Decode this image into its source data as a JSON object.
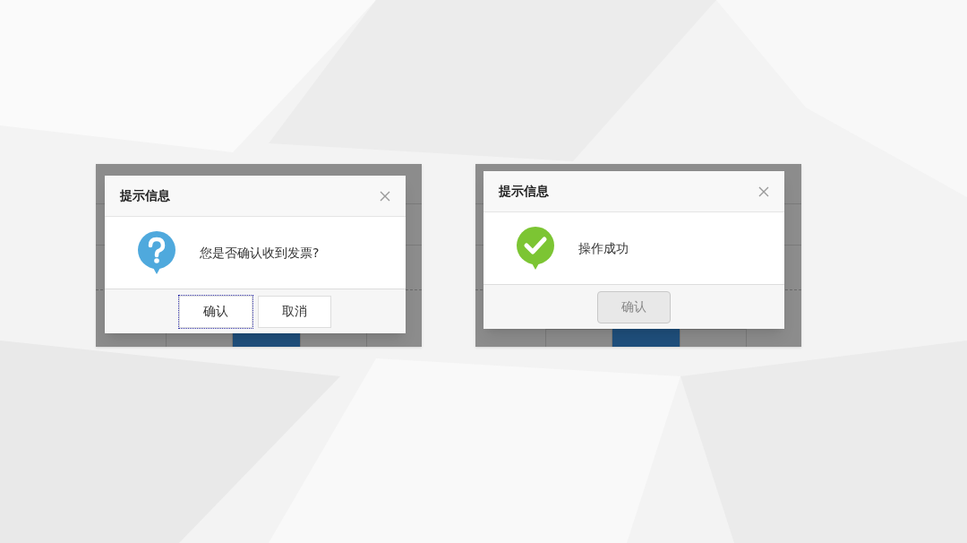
{
  "screenshots": [
    {
      "dialog": {
        "title": "提示信息",
        "kind": "question",
        "message": "您是否确认收到发票?",
        "buttons": [
          {
            "label": "确认",
            "focused": true,
            "disabled": false
          },
          {
            "label": "取消",
            "focused": false,
            "disabled": false
          }
        ]
      }
    },
    {
      "dialog": {
        "title": "提示信息",
        "kind": "success",
        "message": "操作成功",
        "buttons": [
          {
            "label": "确认",
            "focused": false,
            "disabled": true
          }
        ]
      }
    }
  ]
}
